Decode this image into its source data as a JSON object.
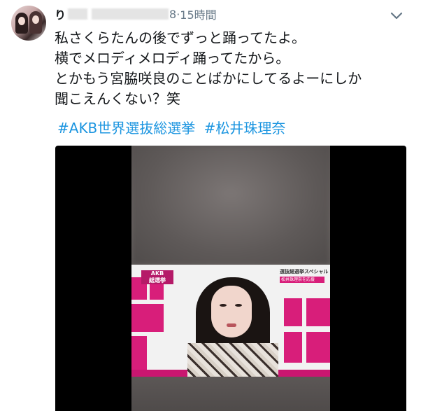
{
  "tweet": {
    "username": "り",
    "handle_tail": "8",
    "time_separator": " · ",
    "time": "15時間",
    "lines": [
      "私さくらたんの後でずっと踊ってたよ。",
      "横でメロディメロディ踊ってたから。",
      "とかもう宮脇咲良のことばかにしてるよーにしか",
      "聞こえんくない？笑"
    ],
    "hashtags": [
      "#AKB世界選抜総選挙",
      "#松井珠理奈"
    ]
  },
  "video_overlay": {
    "logo": "AKB\n総選挙",
    "caption_title": "選抜総選挙スペシャル",
    "caption_sub": "松井珠理奈を応援"
  },
  "icons": {
    "caret": "chevron-down-icon"
  },
  "colors": {
    "link": "#1b95e0",
    "text": "#14171a",
    "muted": "#657786",
    "pink": "#d81e7a"
  }
}
